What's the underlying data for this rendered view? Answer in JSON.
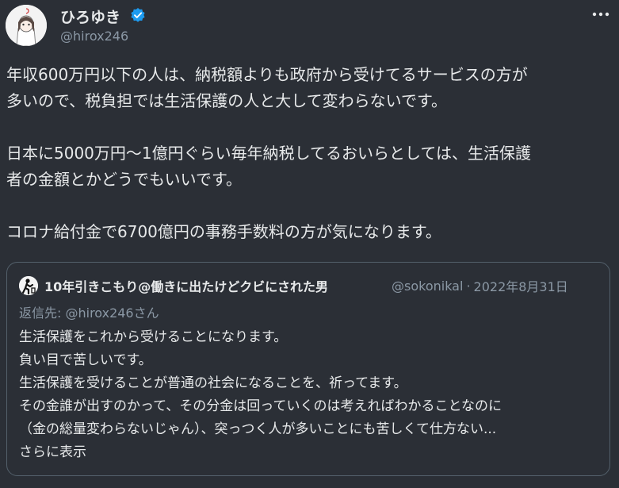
{
  "author": {
    "name": "ひろゆき",
    "handle": "@hirox246",
    "verified": true
  },
  "more_icon": "more-horizontal-icon",
  "tweet": {
    "lines": [
      "年収600万円以下の人は、納税額よりも政府から受けてるサービスの方が",
      "多いので、税負担では生活保護の人と大して変わらないです。",
      "日本に5000万円〜1億円ぐらい毎年納税してるおいらとしては、生活保護",
      "者の金額とかどうでもいいです。",
      "コロナ給付金で6700億円の事務手数料の方が気になります。"
    ]
  },
  "quote": {
    "name": "10年引きこもり@働きに出たけどクビにされた男",
    "handle": "@sokonikal",
    "separator": "·",
    "date": "2022年8月31日",
    "reply_prefix": "返信先: ",
    "reply_to": "@hirox246さん",
    "lines": [
      "生活保護をこれから受けることになります。",
      "負い目で苦しいです。",
      "生活保護を受けることが普通の社会になることを、祈ってます。",
      "その金誰が出すのかって、その分金は回っていくのは考えればわかることなのに",
      "（金の総量変わらないじゃん）、突っつく人が多いことにも苦しくて仕方ない..."
    ],
    "show_more": "さらに表示"
  },
  "colors": {
    "background": "#2b2f36",
    "text": "#e7e9ea",
    "secondary": "#8b98a5",
    "verified": "#1d9bf0",
    "border": "#53606b"
  }
}
